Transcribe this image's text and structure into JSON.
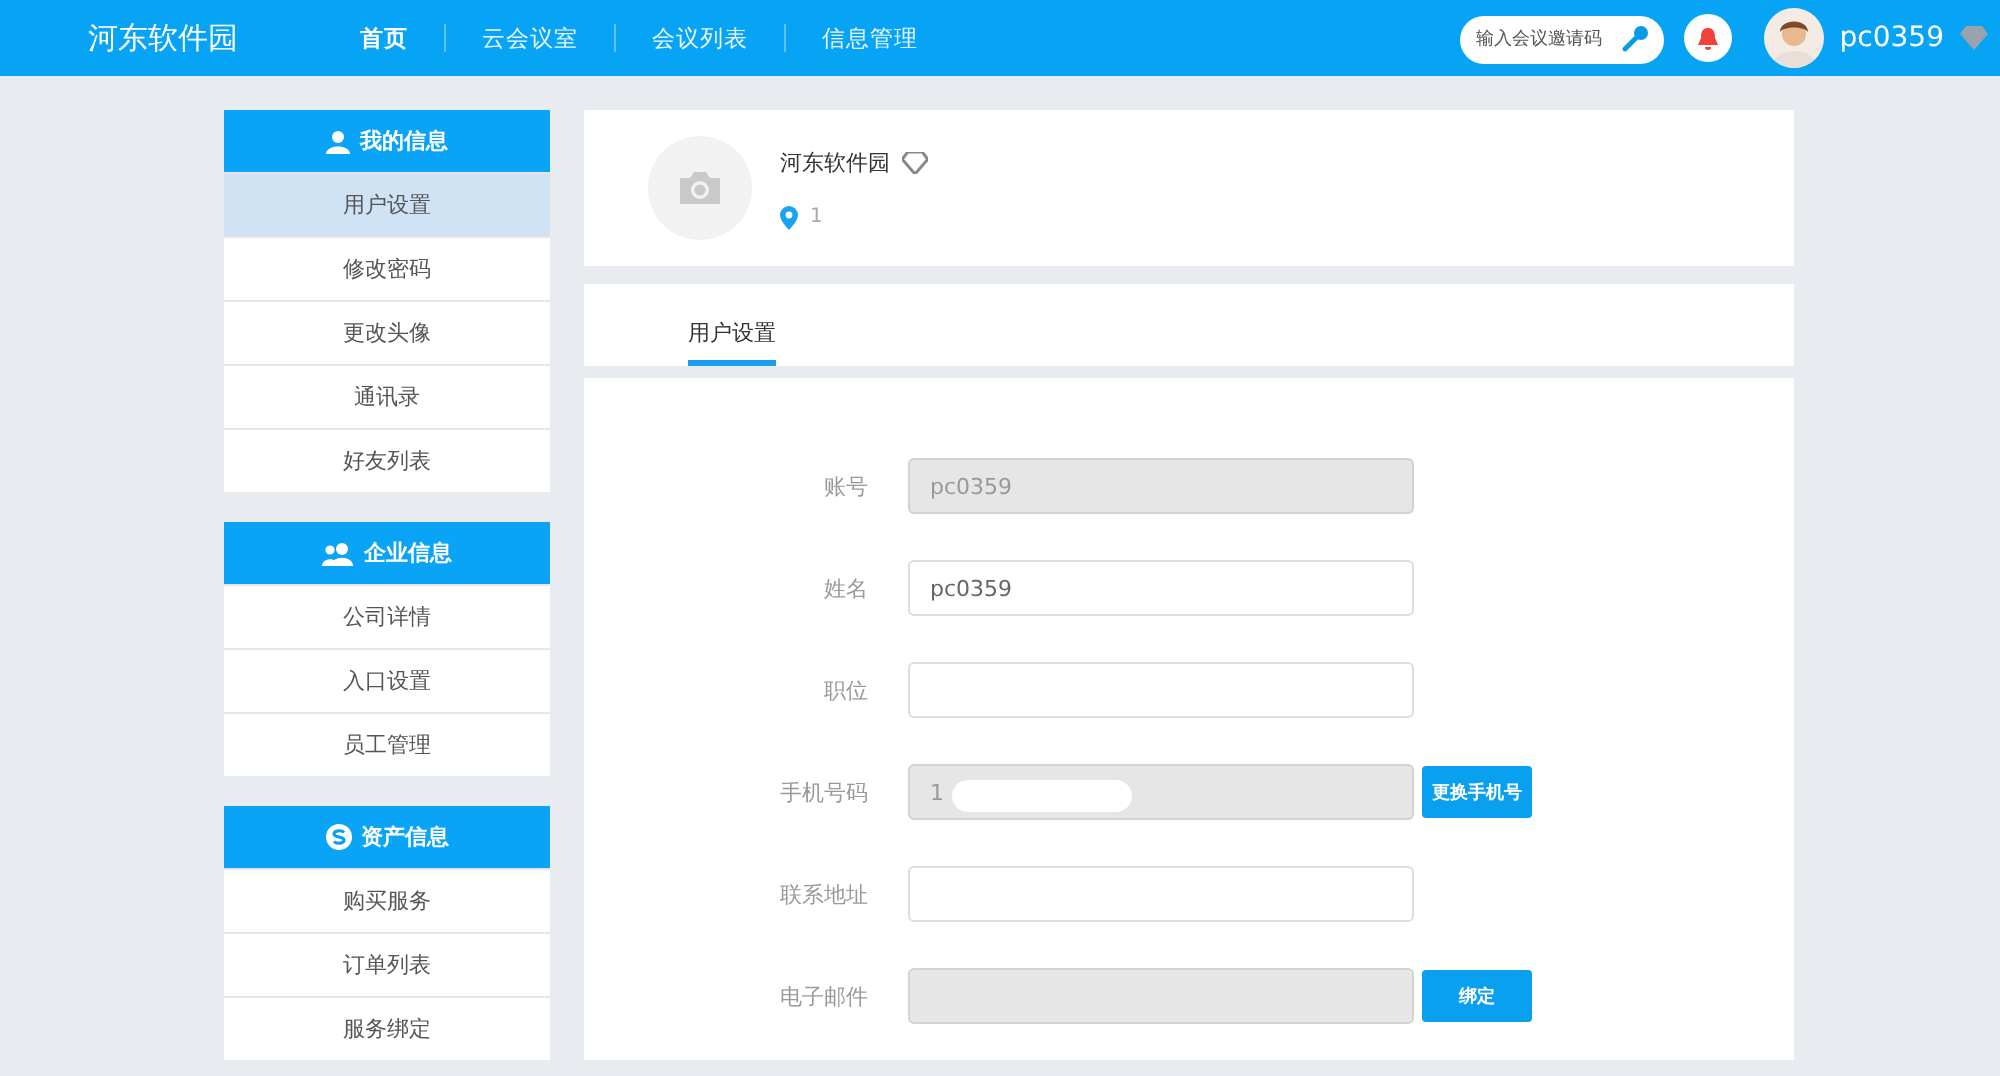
{
  "header": {
    "logo": "河东软件园",
    "nav": [
      {
        "label": "首页",
        "selected": true
      },
      {
        "label": "云会议室",
        "selected": false
      },
      {
        "label": "会议列表",
        "selected": false
      },
      {
        "label": "信息管理",
        "selected": false
      }
    ],
    "invite_search": {
      "placeholder": "输入会议邀请码"
    },
    "username": "pc0359"
  },
  "sidebar": [
    {
      "title": "我的信息",
      "kind": "person",
      "items": [
        {
          "label": "用户设置",
          "selected": true
        },
        {
          "label": "修改密码",
          "selected": false
        },
        {
          "label": "更改头像",
          "selected": false
        },
        {
          "label": "通讯录",
          "selected": false
        },
        {
          "label": "好友列表",
          "selected": false
        }
      ]
    },
    {
      "title": "企业信息",
      "kind": "group",
      "items": [
        {
          "label": "公司详情",
          "selected": false
        },
        {
          "label": "入口设置",
          "selected": false
        },
        {
          "label": "员工管理",
          "selected": false
        }
      ]
    },
    {
      "title": "资产信息",
      "kind": "coin",
      "items": [
        {
          "label": "购买服务",
          "selected": false
        },
        {
          "label": "订单列表",
          "selected": false
        },
        {
          "label": "服务绑定",
          "selected": false
        }
      ]
    }
  ],
  "profile": {
    "name": "河东软件园",
    "location": "1"
  },
  "tabs": [
    {
      "label": "用户设置",
      "selected": true
    }
  ],
  "form": [
    {
      "label": "账号",
      "value": "pc0359",
      "disabled": true
    },
    {
      "label": "姓名",
      "value": "pc0359",
      "disabled": false
    },
    {
      "label": "职位",
      "disabled": false
    },
    {
      "label": "手机号码",
      "value": "1",
      "disabled": true,
      "redacted": true,
      "button": "更换手机号"
    },
    {
      "label": "联系地址",
      "disabled": false
    },
    {
      "label": "电子邮件",
      "disabled": true,
      "button": "绑定"
    }
  ]
}
